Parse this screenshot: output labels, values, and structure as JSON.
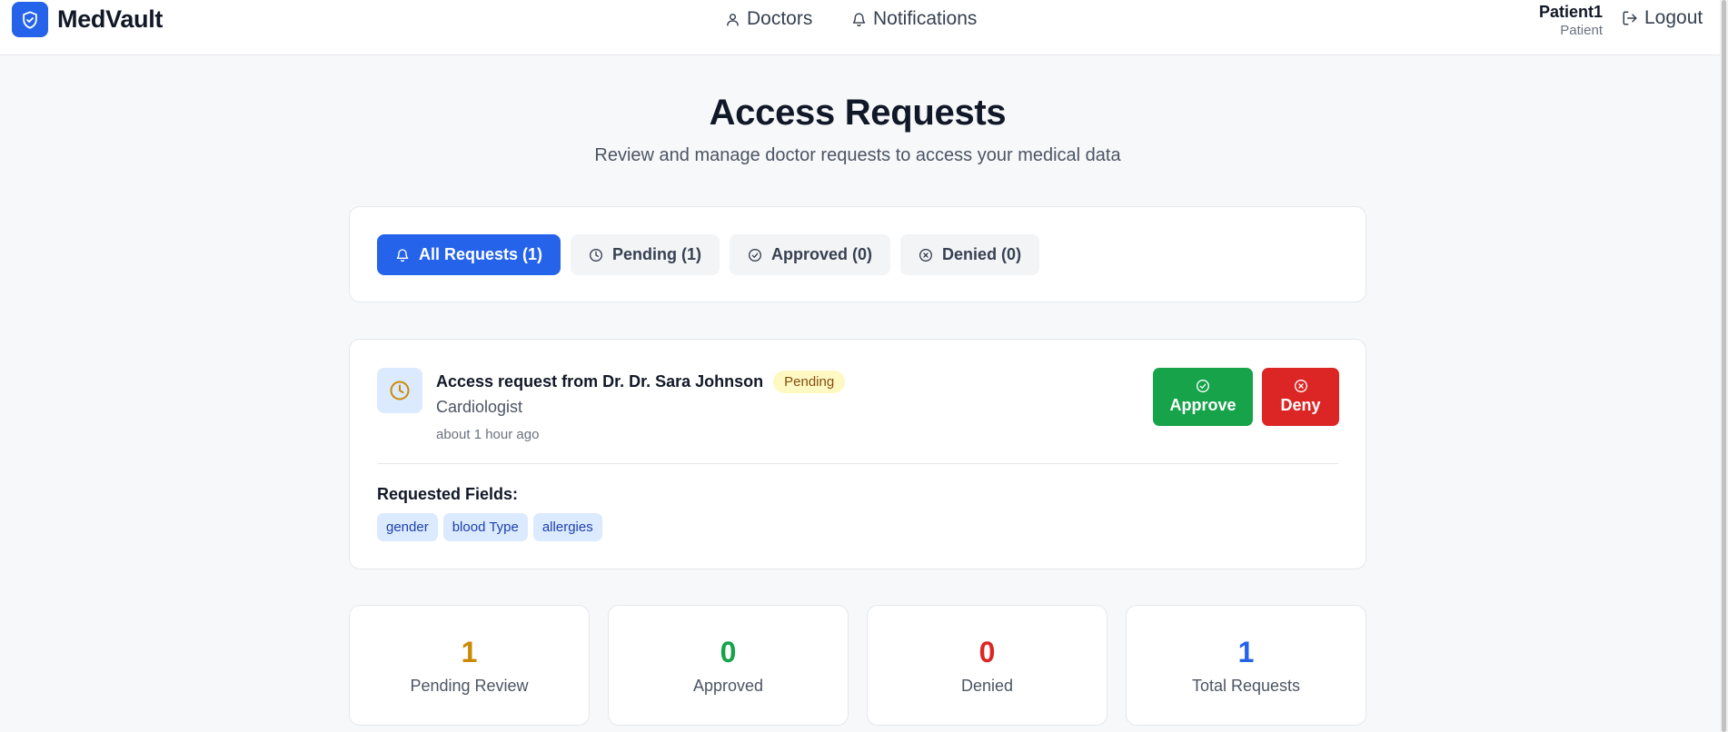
{
  "header": {
    "brand": "MedVault",
    "nav": [
      {
        "label": "Doctors",
        "icon": "user-icon"
      },
      {
        "label": "Notifications",
        "icon": "bell-icon"
      }
    ],
    "user": {
      "name": "Patient1",
      "role": "Patient"
    },
    "logout_label": "Logout"
  },
  "main": {
    "title": "Access Requests",
    "subtitle": "Review and manage doctor requests to access your medical data"
  },
  "tabs": [
    {
      "label": "All Requests (1)",
      "icon": "bell-icon",
      "active": true
    },
    {
      "label": "Pending (1)",
      "icon": "clock-icon",
      "active": false
    },
    {
      "label": "Approved (0)",
      "icon": "check-circle-icon",
      "active": false
    },
    {
      "label": "Denied (0)",
      "icon": "x-circle-icon",
      "active": false
    }
  ],
  "request": {
    "title": "Access request from Dr. Dr. Sara Johnson",
    "status": "Pending",
    "specialty": "Cardiologist",
    "time": "about 1 hour ago",
    "approve_label": "Approve",
    "deny_label": "Deny",
    "fields_label": "Requested Fields:",
    "fields": [
      "gender",
      "blood Type",
      "allergies"
    ]
  },
  "stats": [
    {
      "value": "1",
      "label": "Pending Review",
      "color": "#ca8a04"
    },
    {
      "value": "0",
      "label": "Approved",
      "color": "#16a34a"
    },
    {
      "value": "0",
      "label": "Denied",
      "color": "#dc2626"
    },
    {
      "value": "1",
      "label": "Total Requests",
      "color": "#2563eb"
    }
  ],
  "colors": {
    "primary": "#2563eb",
    "approve": "#16a34a",
    "deny": "#dc2626",
    "pending": "#ca8a04"
  }
}
